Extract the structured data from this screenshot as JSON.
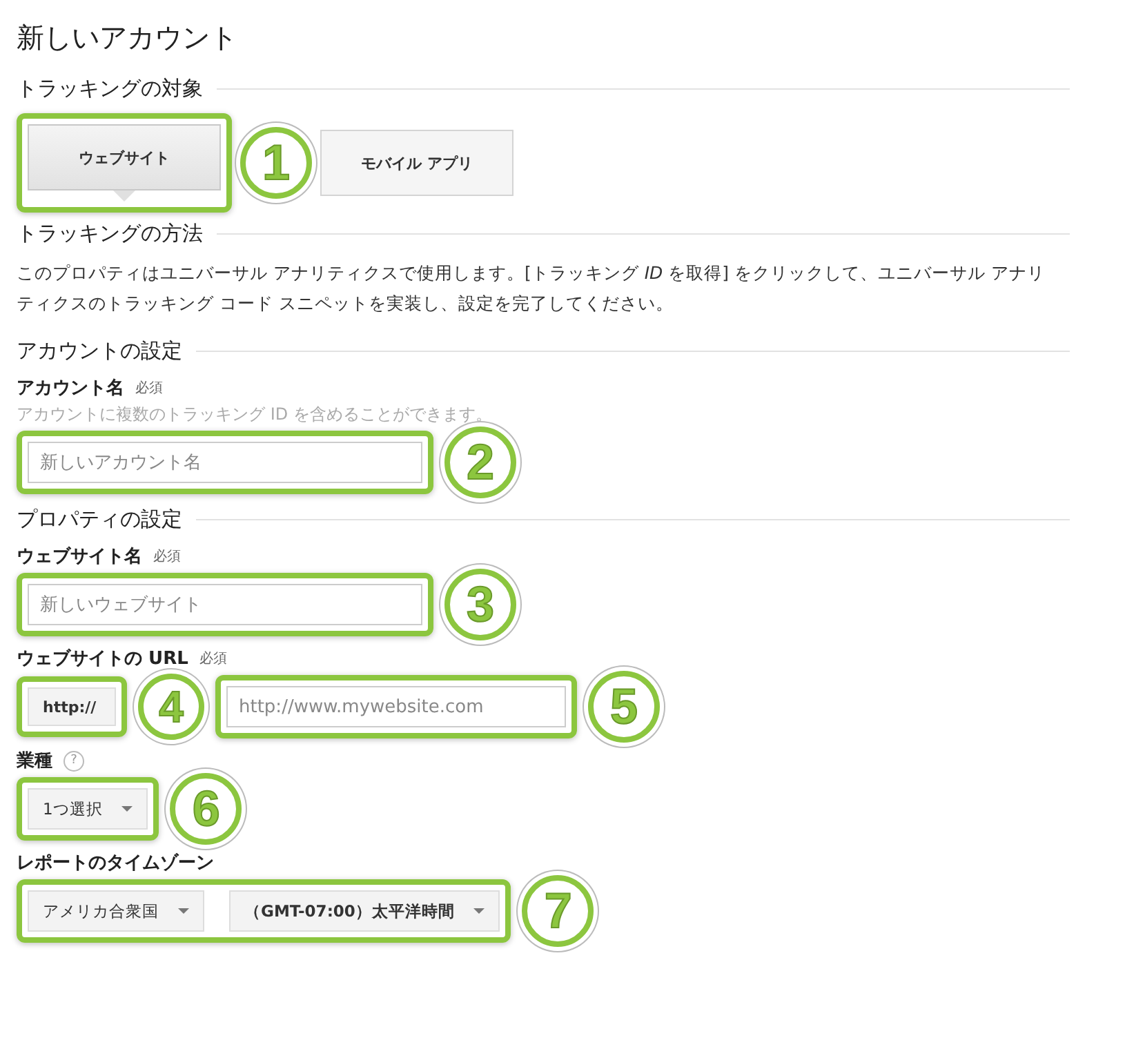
{
  "title": "新しいアカウント",
  "target": {
    "heading": "トラッキングの対象",
    "callout": "1",
    "options": [
      {
        "label": "ウェブサイト",
        "selected": true
      },
      {
        "label": "モバイル アプリ",
        "selected": false
      }
    ]
  },
  "method": {
    "heading": "トラッキングの方法",
    "text": "このプロパティはユニバーサル アナリティクスで使用します。[トラッキング *ID* を取得] をクリックして、ユニバーサル アナリティクスのトラッキング コード スニペットを実装し、設定を完了してください。"
  },
  "account": {
    "heading": "アカウントの設定",
    "label": "アカウント名",
    "required": "必須",
    "help": "アカウントに複数のトラッキング ID を含めることができます。",
    "placeholder": "新しいアカウント名",
    "callout": "2"
  },
  "property": {
    "heading": "プロパティの設定",
    "site_name": {
      "label": "ウェブサイト名",
      "required": "必須",
      "placeholder": "新しいウェブサイト",
      "callout": "3"
    },
    "site_url": {
      "label": "ウェブサイトの URL",
      "required": "必須",
      "protocol": "http://",
      "protocol_callout": "4",
      "placeholder": "http://www.mywebsite.com",
      "callout": "5"
    },
    "industry": {
      "label": "業種",
      "help_icon": "?",
      "value": "1つ選択",
      "callout": "6"
    },
    "timezone": {
      "label": "レポートのタイムゾーン",
      "country": "アメリカ合衆国",
      "zone": "（GMT-07:00）太平洋時間",
      "callout": "7"
    }
  }
}
